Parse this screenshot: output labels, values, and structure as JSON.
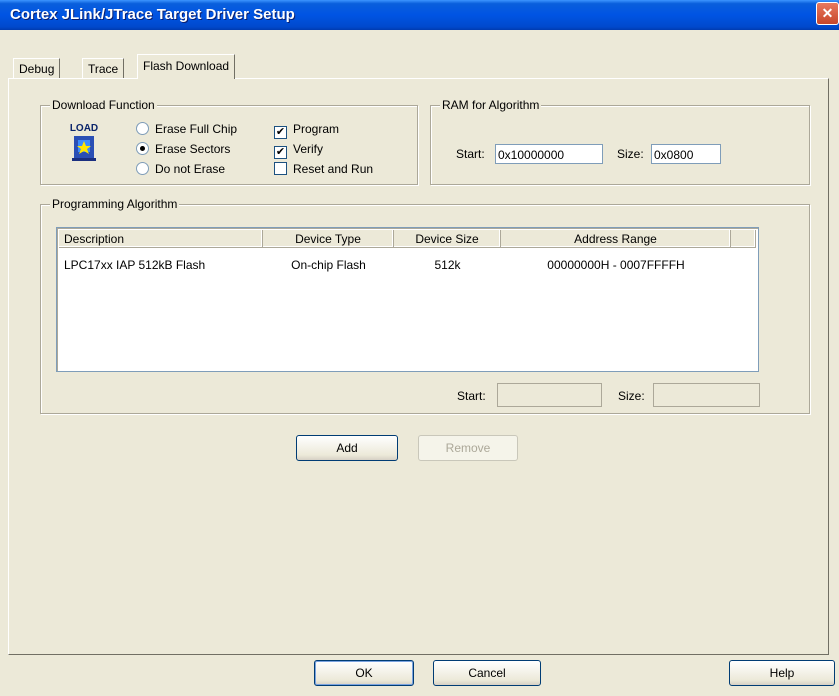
{
  "window": {
    "title": "Cortex JLink/JTrace Target Driver Setup",
    "close_glyph": "✕"
  },
  "tabs": [
    {
      "label": "Debug"
    },
    {
      "label": "Trace"
    },
    {
      "label": "Flash Download"
    }
  ],
  "download_function": {
    "label": "Download Function",
    "icon_text": "LOAD",
    "radios": [
      {
        "label": "Erase Full Chip",
        "selected": false
      },
      {
        "label": "Erase Sectors",
        "selected": true
      },
      {
        "label": "Do not Erase",
        "selected": false
      }
    ],
    "checkboxes": [
      {
        "label": "Program",
        "checked": true
      },
      {
        "label": "Verify",
        "checked": true
      },
      {
        "label": "Reset and Run",
        "checked": false
      }
    ]
  },
  "ram": {
    "label": "RAM for Algorithm",
    "start_label": "Start:",
    "start_value": "0x10000000",
    "size_label": "Size:",
    "size_value": "0x0800"
  },
  "programming": {
    "label": "Programming Algorithm",
    "columns": [
      "Description",
      "Device Type",
      "Device Size",
      "Address Range"
    ],
    "rows": [
      {
        "description": "LPC17xx IAP 512kB Flash",
        "device_type": "On-chip Flash",
        "device_size": "512k",
        "address_range": "00000000H - 0007FFFFH"
      }
    ],
    "start_label": "Start:",
    "start_value": "",
    "size_label": "Size:",
    "size_value": ""
  },
  "actions": {
    "add": "Add",
    "remove": "Remove"
  },
  "footer": {
    "ok": "OK",
    "cancel": "Cancel",
    "help": "Help"
  }
}
